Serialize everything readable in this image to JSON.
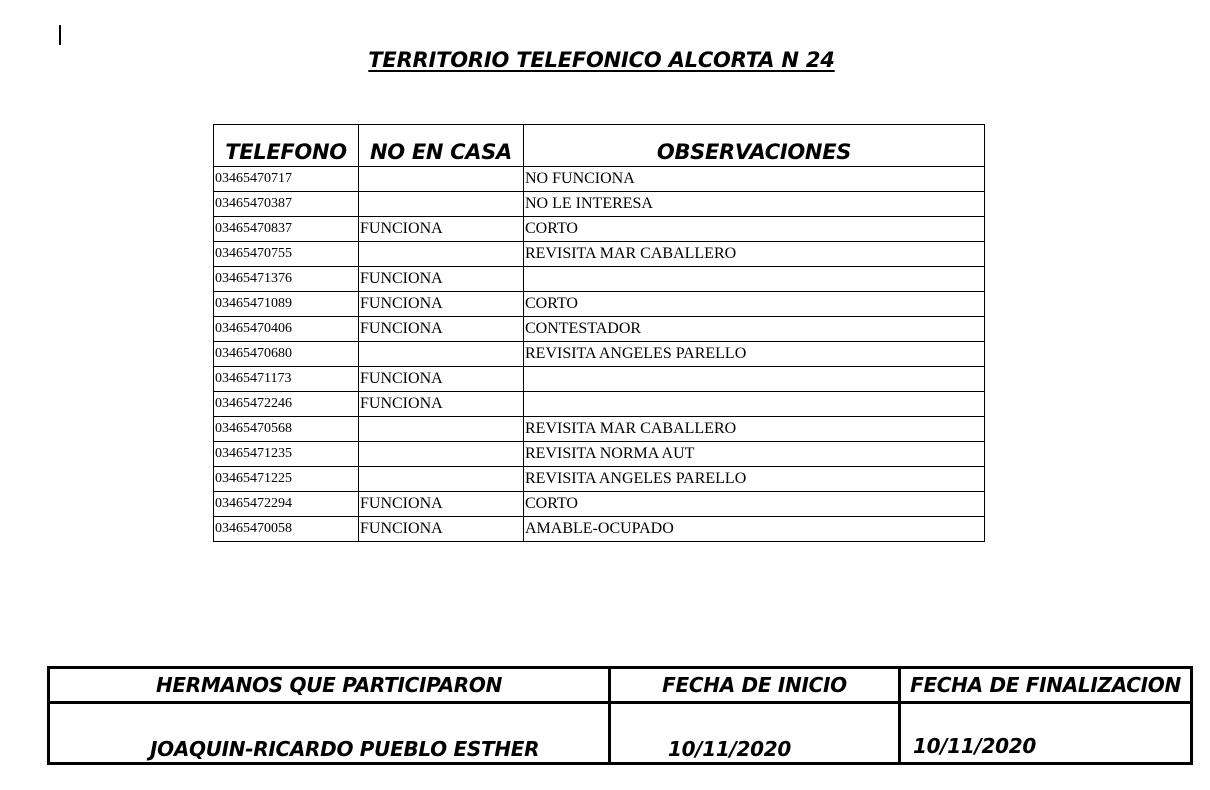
{
  "title": "TERRITORIO TELEFONICO ALCORTA N 24",
  "table": {
    "headers": [
      "TELEFONO",
      "NO EN CASA",
      "OBSERVACIONES"
    ],
    "rows": [
      {
        "telefono": "03465470717",
        "no_en_casa": "",
        "observaciones": "NO FUNCIONA"
      },
      {
        "telefono": "03465470387",
        "no_en_casa": "",
        "observaciones": "NO LE INTERESA"
      },
      {
        "telefono": "03465470837",
        "no_en_casa": "FUNCIONA",
        "observaciones": "CORTO"
      },
      {
        "telefono": "03465470755",
        "no_en_casa": "",
        "observaciones": "REVISITA MAR CABALLERO"
      },
      {
        "telefono": "03465471376",
        "no_en_casa": "FUNCIONA",
        "observaciones": ""
      },
      {
        "telefono": "03465471089",
        "no_en_casa": "FUNCIONA",
        "observaciones": "CORTO"
      },
      {
        "telefono": "03465470406",
        "no_en_casa": "FUNCIONA",
        "observaciones": "CONTESTADOR"
      },
      {
        "telefono": "03465470680",
        "no_en_casa": "",
        "observaciones": "REVISITA ANGELES PARELLO"
      },
      {
        "telefono": "03465471173",
        "no_en_casa": "FUNCIONA",
        "observaciones": ""
      },
      {
        "telefono": "03465472246",
        "no_en_casa": "FUNCIONA",
        "observaciones": ""
      },
      {
        "telefono": "03465470568",
        "no_en_casa": "",
        "observaciones": "REVISITA MAR CABALLERO"
      },
      {
        "telefono": "03465471235",
        "no_en_casa": "",
        "observaciones": "REVISITA NORMA AUT"
      },
      {
        "telefono": "03465471225",
        "no_en_casa": "",
        "observaciones": "REVISITA ANGELES PARELLO"
      },
      {
        "telefono": "03465472294",
        "no_en_casa": "FUNCIONA",
        "observaciones": "CORTO"
      },
      {
        "telefono": "03465470058",
        "no_en_casa": "FUNCIONA",
        "observaciones": "AMABLE-OCUPADO"
      }
    ]
  },
  "footer": {
    "headers": {
      "hermanos": "HERMANOS QUE PARTICIPARON",
      "fecha_inicio": "FECHA DE INICIO",
      "fecha_fin": "FECHA DE FINALIZACION"
    },
    "values": {
      "hermanos": "JOAQUIN-RICARDO PUEBLO ESTHER",
      "fecha_inicio": "10/11/2020",
      "fecha_fin": "10/11/2020"
    }
  }
}
